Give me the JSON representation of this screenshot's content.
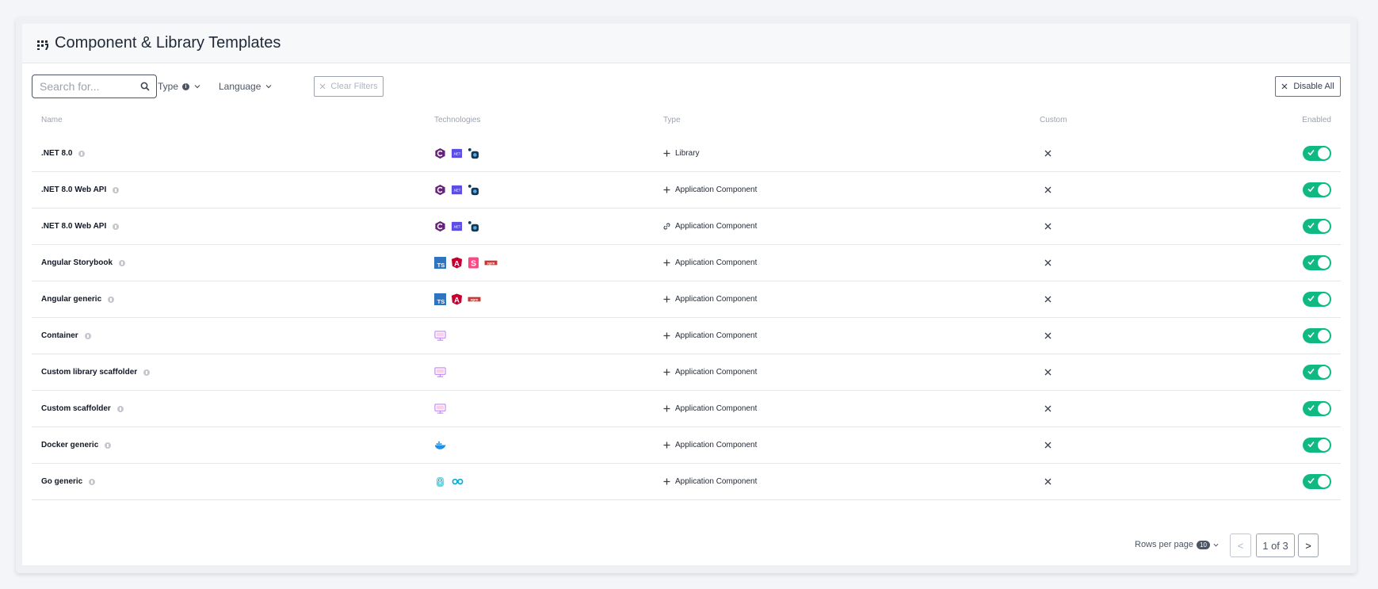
{
  "header": {
    "title": "Component & Library Templates"
  },
  "toolbar": {
    "search_placeholder": "Search for...",
    "type_filter": "Type",
    "language_filter": "Language",
    "clear_filters": "Clear Filters",
    "disable_all": "Disable All"
  },
  "table": {
    "columns": [
      "Name",
      "Technologies",
      "Type",
      "Custom",
      "Enabled"
    ],
    "rows": [
      {
        "name": ".NET 8.0",
        "technologies": [
          "csharp",
          "dotnet",
          "opentelemetry"
        ],
        "type_icon": "plus",
        "type": "Library",
        "custom": false,
        "enabled": true
      },
      {
        "name": ".NET 8.0 Web API",
        "technologies": [
          "csharp",
          "dotnet",
          "opentelemetry"
        ],
        "type_icon": "plus",
        "type": "Application Component",
        "custom": false,
        "enabled": true
      },
      {
        "name": ".NET 8.0 Web API",
        "technologies": [
          "csharp",
          "dotnet",
          "opentelemetry"
        ],
        "type_icon": "link",
        "type": "Application Component",
        "custom": false,
        "enabled": true
      },
      {
        "name": "Angular Storybook",
        "technologies": [
          "typescript",
          "angular",
          "storybook",
          "npm"
        ],
        "type_icon": "plus",
        "type": "Application Component",
        "custom": false,
        "enabled": true
      },
      {
        "name": "Angular generic",
        "technologies": [
          "typescript",
          "angular",
          "npm"
        ],
        "type_icon": "plus",
        "type": "Application Component",
        "custom": false,
        "enabled": true
      },
      {
        "name": "Container",
        "technologies": [
          "container"
        ],
        "type_icon": "plus",
        "type": "Application Component",
        "custom": false,
        "enabled": true
      },
      {
        "name": "Custom library scaffolder",
        "technologies": [
          "container"
        ],
        "type_icon": "plus",
        "type": "Application Component",
        "custom": false,
        "enabled": true
      },
      {
        "name": "Custom scaffolder",
        "technologies": [
          "container"
        ],
        "type_icon": "plus",
        "type": "Application Component",
        "custom": false,
        "enabled": true
      },
      {
        "name": "Docker generic",
        "technologies": [
          "docker"
        ],
        "type_icon": "plus",
        "type": "Application Component",
        "custom": false,
        "enabled": true
      },
      {
        "name": "Go generic",
        "technologies": [
          "gopher",
          "golang"
        ],
        "type_icon": "plus",
        "type": "Application Component",
        "custom": false,
        "enabled": true
      }
    ]
  },
  "pagination": {
    "rows_per_page_label": "Rows per page",
    "rows_per_page_value": "10",
    "prev": "<",
    "page_indicator": "1 of 3",
    "next": ">"
  },
  "colors": {
    "toggle_on": "#10b981",
    "text": "#1f2937",
    "muted": "#9ca3af"
  }
}
